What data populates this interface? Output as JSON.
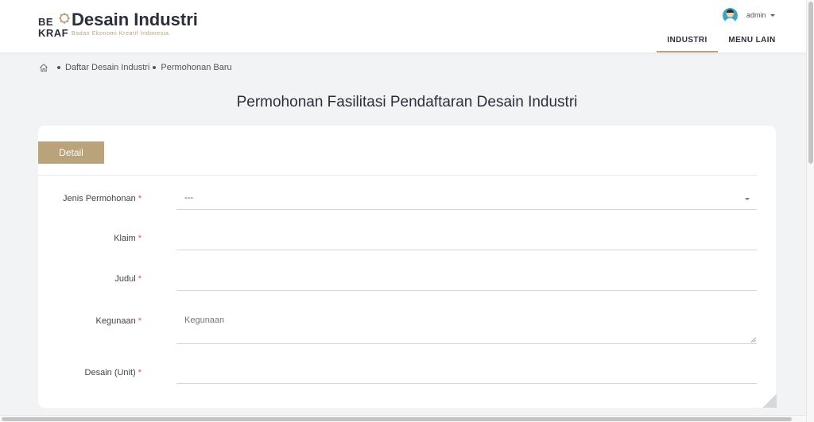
{
  "header": {
    "logo_be": "BE",
    "logo_kraf": "KRAF",
    "app_title": "Desain Industri",
    "app_subtitle": "Badan Ekonomi Kreatif Indonesia",
    "user_name": "admin",
    "nav": [
      {
        "label": "INDUSTRI",
        "active": true
      },
      {
        "label": "MENU LAIN",
        "active": false
      }
    ]
  },
  "breadcrumb": {
    "items": [
      "Daftar Desain Industri",
      "Permohonan Baru"
    ]
  },
  "page_title": "Permohonan Fasilitasi Pendaftaran Desain Industri",
  "form": {
    "tab_label": "Detail",
    "fields": [
      {
        "label": "Jenis Permohonan",
        "required_mark": "*",
        "type": "select",
        "value": "---"
      },
      {
        "label": "Klaim",
        "required_mark": "*",
        "type": "text",
        "value": "",
        "placeholder": ""
      },
      {
        "label": "Judul",
        "required_mark": "*",
        "type": "text",
        "value": "",
        "placeholder": ""
      },
      {
        "label": "Kegunaan",
        "required_mark": "*",
        "type": "textarea",
        "value": "",
        "placeholder": "Kegunaan"
      },
      {
        "label": "Desain (Unit)",
        "required_mark": "*",
        "type": "text",
        "value": "",
        "placeholder": ""
      }
    ]
  },
  "colors": {
    "accent": "#b8a37a",
    "text_dark": "#2b2f3a",
    "required": "#d9534f",
    "background": "#f2f3f5"
  },
  "icons": [
    "home-icon",
    "user-avatar",
    "chevron-down-icon",
    "logo-star-icon"
  ]
}
